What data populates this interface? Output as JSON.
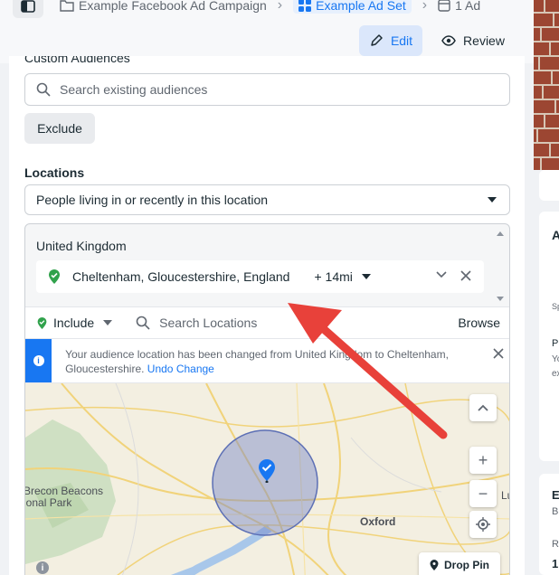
{
  "breadcrumb": {
    "campaign": "Example Facebook Ad Campaign",
    "ad_set": "Example Ad Set",
    "ad": "1 Ad"
  },
  "header": {
    "edit_label": "Edit",
    "review_label": "Review"
  },
  "audience": {
    "section_heading_partial": "Custom Audiences",
    "search_placeholder": "Search existing audiences",
    "exclude_label": "Exclude"
  },
  "locations": {
    "label": "Locations",
    "type_select": "People living in or recently in this location",
    "country": "United Kingdom",
    "selected": {
      "city": "Cheltenham, Gloucestershire, England",
      "radius": "+ 14mi"
    },
    "include_label": "Include",
    "search_placeholder": "Search Locations",
    "browse_label": "Browse"
  },
  "notice": {
    "text": "Your audience location has been changed from United Kingdom to Cheltenham, Gloucestershire.",
    "undo_label": "Undo Change"
  },
  "map": {
    "labels": {
      "brecon": "Brecon Beacons",
      "park": "ional Park",
      "oxford": "Oxford",
      "edge": "Lu"
    },
    "drop_pin_label": "Drop Pin",
    "zoom_in": "+",
    "zoom_out": "−"
  },
  "right_column": {
    "frag_a": "A",
    "frag_sp": "Sp",
    "frag_p": "P",
    "frag_y": "Yo",
    "frag_ex": "ex",
    "frag_e": "E",
    "frag_b": "B",
    "frag_r": "R",
    "frag_1": "1"
  },
  "colors": {
    "accent": "#1877f2",
    "annotation_arrow": "#e8413a",
    "pin_green": "#31a24c"
  }
}
